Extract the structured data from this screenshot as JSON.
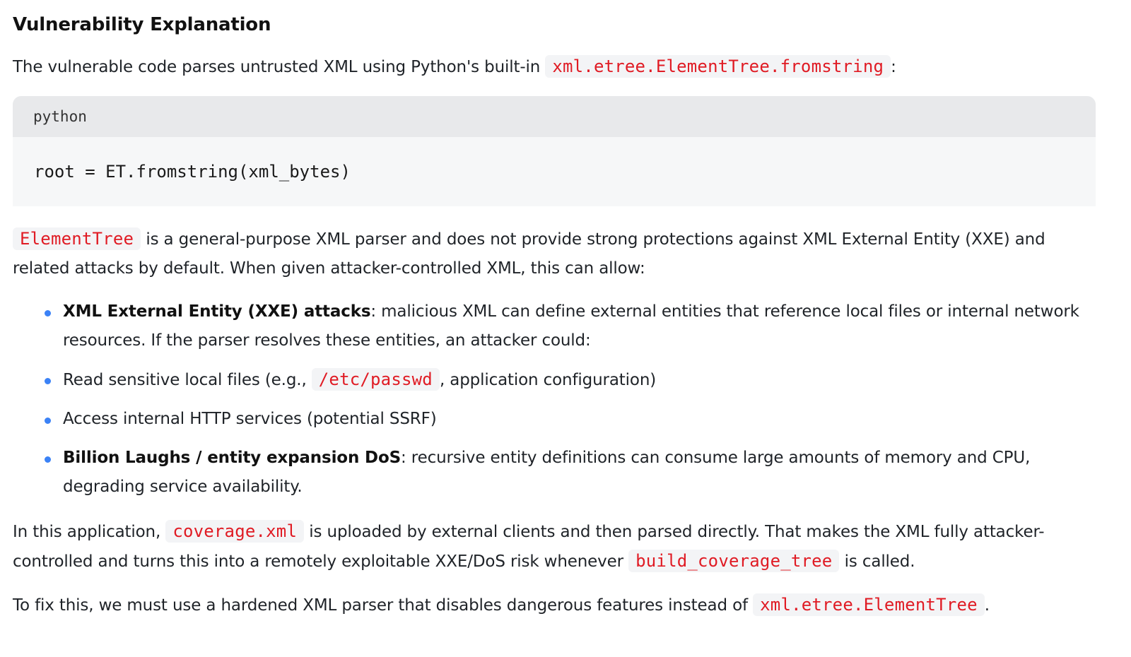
{
  "heading": "Vulnerability Explanation",
  "intro": {
    "text": "The vulnerable code parses untrusted XML using Python's built-in",
    "code": "xml.etree.ElementTree.fromstring",
    "suffix": ":"
  },
  "code_block": {
    "language": "python",
    "code": "root = ET.fromstring(xml_bytes)"
  },
  "para2": {
    "code": "ElementTree",
    "text": "is a general-purpose XML parser and does not provide strong protections against XML External Entity (XXE) and related attacks by default. When given attacker-controlled XML, this can allow:"
  },
  "bullets": [
    {
      "bold": "XML External Entity (XXE) attacks",
      "text": ": malicious XML can define external entities that reference local files or internal network resources. If the parser resolves these entities, an attacker could:"
    },
    {
      "text_before": "Read sensitive local files (e.g.,",
      "code": "/etc/passwd",
      "text_after": ", application configuration)"
    },
    {
      "text": "Access internal HTTP services (potential SSRF)"
    },
    {
      "bold": "Billion Laughs / entity expansion DoS",
      "text": ": recursive entity definitions can consume large amounts of memory and CPU, degrading service availability."
    }
  ],
  "para3": {
    "text1": "In this application,",
    "code1": "coverage.xml",
    "text2": "is uploaded by external clients and then parsed directly. That makes the XML fully attacker-controlled and turns this into a remotely exploitable XXE/DoS risk whenever",
    "code2": "build_coverage_tree",
    "text3": "is called."
  },
  "para4": {
    "text": "To fix this, we must use a hardened XML parser that disables dangerous features instead of",
    "code": "xml.etree.ElementTree",
    "suffix": "."
  },
  "colors": {
    "inline_code": "#e01b24",
    "bullet": "#3b82f6",
    "code_header_bg": "#e8e9eb",
    "code_body_bg": "#f6f7f8"
  }
}
